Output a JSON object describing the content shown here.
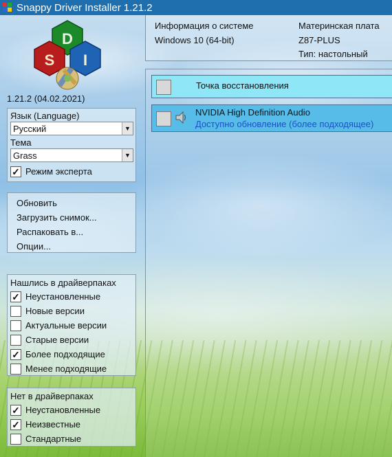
{
  "window": {
    "title": "Snappy Driver Installer 1.21.2"
  },
  "logo": {
    "letters": [
      "S",
      "D",
      "I"
    ],
    "colors": {
      "s_tile": "#b81d1d",
      "d_tile": "#1d8a2a",
      "i_tile": "#1f63b5"
    }
  },
  "version": "1.21.2 (04.02.2021)",
  "settings": {
    "language_label": "Язык (Language)",
    "language_value": "Русский",
    "theme_label": "Тема",
    "theme_value": "Grass",
    "expert_mode": {
      "label": "Режим эксперта",
      "checked": true
    }
  },
  "actions": [
    {
      "label": "Обновить"
    },
    {
      "label": "Загрузить снимок..."
    },
    {
      "label": "Распаковать в..."
    },
    {
      "label": "Опции..."
    }
  ],
  "found_filters": {
    "title": "Нашлись в драйверпаках",
    "items": [
      {
        "label": "Неустановленные",
        "checked": true
      },
      {
        "label": "Новые версии",
        "checked": false
      },
      {
        "label": "Актуальные версии",
        "checked": false
      },
      {
        "label": "Старые версии",
        "checked": false
      },
      {
        "label": "Более подходящие",
        "checked": true
      },
      {
        "label": "Менее подходящие",
        "checked": false
      }
    ]
  },
  "missing_filters": {
    "title": "Нет в драйверпаках",
    "items": [
      {
        "label": "Неустановленные",
        "checked": true
      },
      {
        "label": "Неизвестные",
        "checked": true
      },
      {
        "label": "Стандартные",
        "checked": false
      }
    ]
  },
  "system_info": {
    "header": "Информация о системе",
    "os": "Windows 10 (64-bit)",
    "board_header": "Материнская плата",
    "board": "Z87-PLUS",
    "type": "Тип: настольный"
  },
  "drivers": {
    "restore_point": "Точка восстановления",
    "items": [
      {
        "name": "NVIDIA High Definition Audio",
        "status": "Доступно обновление (более подходящее)",
        "icon": "speaker-icon"
      }
    ]
  },
  "colors": {
    "titlebar": "#1f6fae",
    "restore_row": "#8fe6f7",
    "update_row": "#57bde8",
    "status_link": "#1a52c2"
  }
}
